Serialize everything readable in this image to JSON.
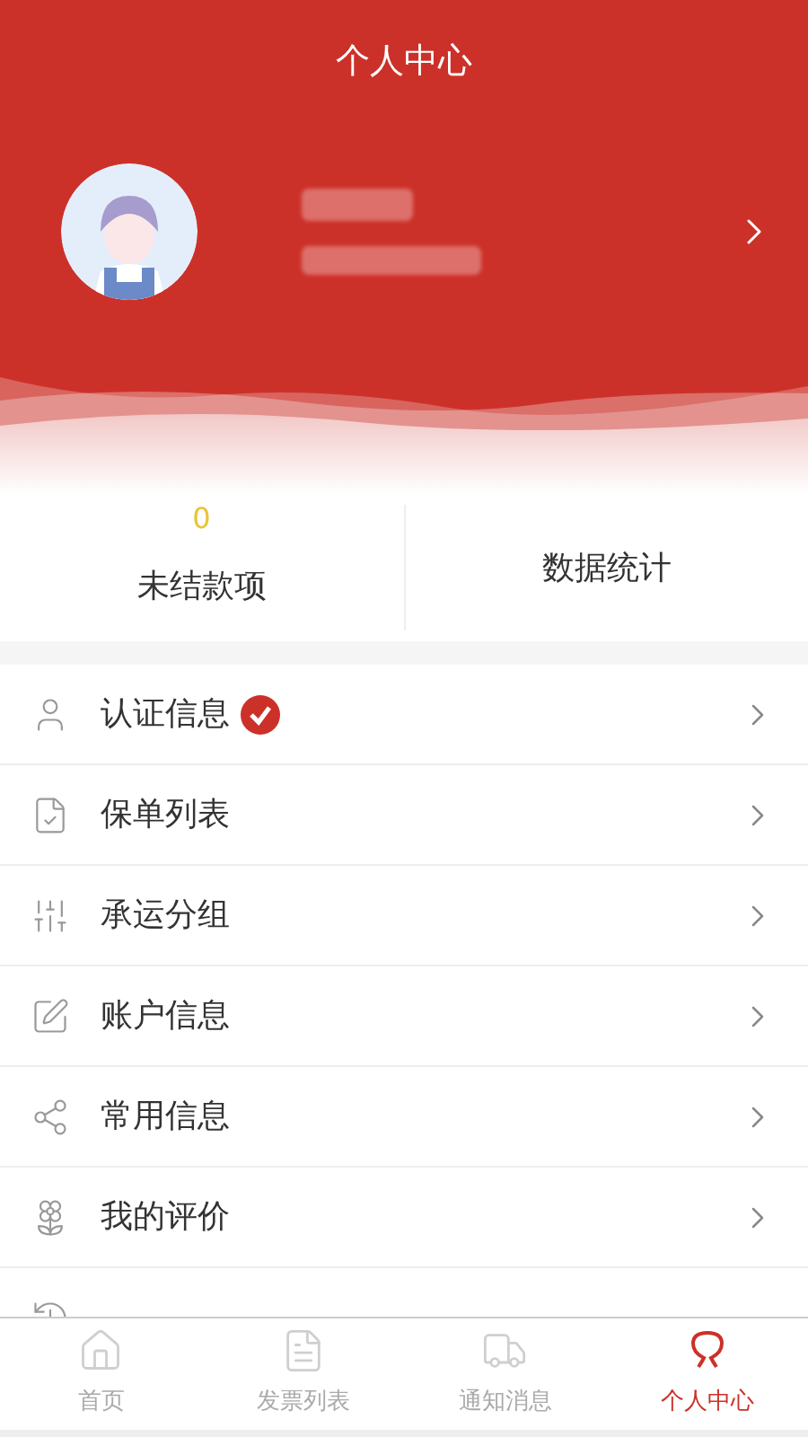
{
  "title": "个人中心",
  "profile": {
    "redacted": true
  },
  "stats": [
    {
      "value": "0",
      "label": "未结款项"
    },
    {
      "label": "数据统计"
    }
  ],
  "menu": [
    {
      "label": "认证信息",
      "verified": true
    },
    {
      "label": "保单列表",
      "verified": false
    },
    {
      "label": "承运分组",
      "verified": false
    },
    {
      "label": "账户信息",
      "verified": false
    },
    {
      "label": "常用信息",
      "verified": false
    },
    {
      "label": "我的评价",
      "verified": false
    }
  ],
  "tabs": [
    {
      "label": "首页",
      "selected": false
    },
    {
      "label": "发票列表",
      "selected": false
    },
    {
      "label": "通知消息",
      "selected": false
    },
    {
      "label": "个人中心",
      "selected": true
    }
  ]
}
